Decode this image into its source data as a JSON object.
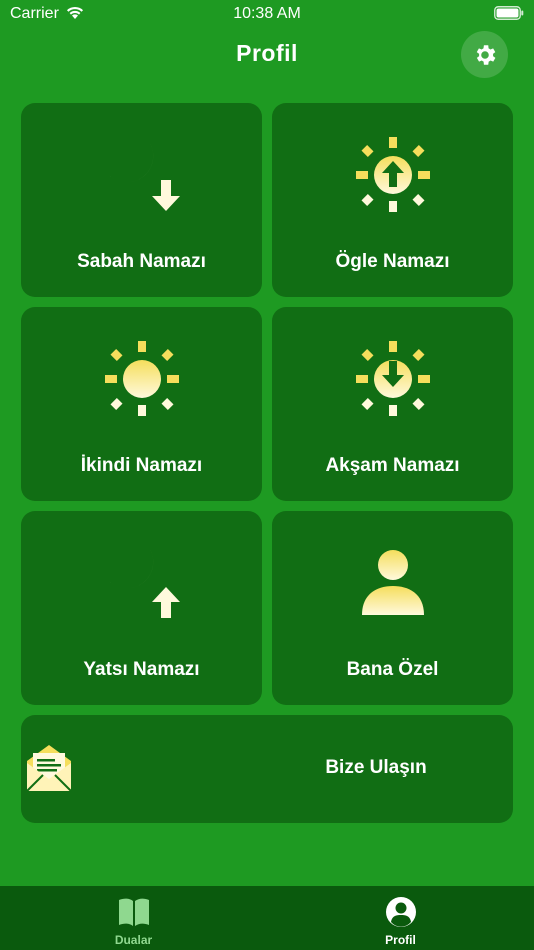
{
  "status_bar": {
    "carrier": "Carrier",
    "time": "10:38 AM",
    "wifi_icon": "wifi-icon",
    "battery_icon": "battery-icon"
  },
  "header": {
    "title": "Profil",
    "settings_icon": "gear-icon"
  },
  "cards": [
    {
      "label": "Sabah Namazı",
      "icon": "moon-down-arrow-icon"
    },
    {
      "label": "Ögle Namazı",
      "icon": "sun-up-arrow-icon"
    },
    {
      "label": "İkindi Namazı",
      "icon": "sun-icon"
    },
    {
      "label": "Akşam Namazı",
      "icon": "sun-down-arrow-icon"
    },
    {
      "label": "Yatsı Namazı",
      "icon": "moon-up-arrow-icon"
    },
    {
      "label": "Bana Özel",
      "icon": "person-icon"
    }
  ],
  "contact": {
    "label": "Bize Ulaşın",
    "icon": "envelope-letter-icon"
  },
  "tabs": [
    {
      "label": "Dualar",
      "icon": "book-icon"
    },
    {
      "label": "Profil",
      "icon": "person-circle-icon"
    }
  ],
  "colors": {
    "background": "#1e9a22",
    "card": "#116e14",
    "tab_bar": "#0a5a0d",
    "icon_yellow": "#fbe373",
    "icon_light": "#fff7d0",
    "tab_inactive": "#8fd88f"
  }
}
